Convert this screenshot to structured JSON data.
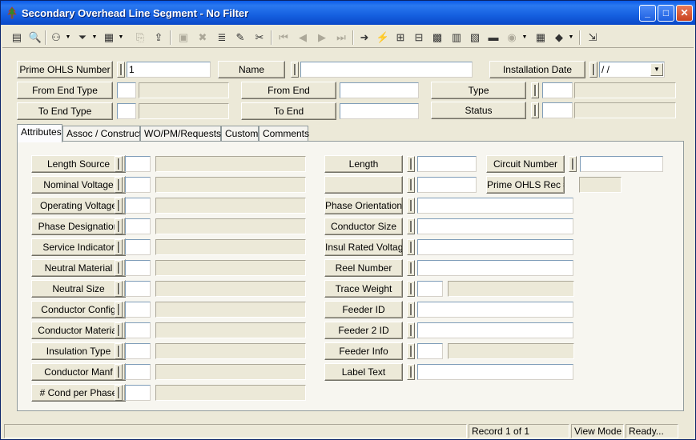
{
  "window": {
    "title": "Secondary Overhead Line Segment - No Filter",
    "buttons": {
      "minimize": "_",
      "maximize": "□",
      "close": "✕"
    }
  },
  "toolbar": {
    "icons": [
      "list-icon",
      "search-icon",
      "binoculars-icon",
      "filter-icon",
      "form-icon",
      "copy-icon",
      "export-icon",
      "save-icon",
      "delete-icon",
      "stack-icon",
      "edit-icon",
      "cut-icon",
      "first-record-icon",
      "prev-record-icon",
      "next-record-icon",
      "last-record-icon",
      "goto-icon",
      "lightning-icon",
      "network-icon",
      "tree-icon",
      "chart-icon",
      "calculator-icon",
      "map-icon",
      "folder-icon",
      "globe-icon",
      "grid-icon",
      "book-icon",
      "exit-icon"
    ]
  },
  "header": {
    "prime_ohls_number": {
      "label": "Prime OHLS Number",
      "value": "1"
    },
    "name": {
      "label": "Name",
      "value": ""
    },
    "installation_date": {
      "label": "Installation Date",
      "value": " /  / "
    },
    "from_end_type": {
      "label": "From End Type",
      "code": "",
      "desc": ""
    },
    "to_end_type": {
      "label": "To End Type",
      "code": "",
      "desc": ""
    },
    "from_end": {
      "label": "From End",
      "value": ""
    },
    "to_end": {
      "label": "To End",
      "value": ""
    },
    "type": {
      "label": "Type",
      "code": "",
      "desc": ""
    },
    "status": {
      "label": "Status",
      "code": "",
      "desc": ""
    }
  },
  "tabs": [
    "Attributes",
    "Assoc / Construct",
    "WO/PM/Requests",
    "Custom",
    "Comments"
  ],
  "attributes": {
    "left": [
      {
        "label": "Length Source",
        "code": "",
        "desc": ""
      },
      {
        "label": "Nominal Voltage",
        "code": "",
        "desc": ""
      },
      {
        "label": "Operating Voltage",
        "code": "",
        "desc": ""
      },
      {
        "label": "Phase Designation",
        "code": "",
        "desc": ""
      },
      {
        "label": "Service Indicator",
        "code": "",
        "desc": ""
      },
      {
        "label": "Neutral Material",
        "code": "",
        "desc": ""
      },
      {
        "label": "Neutral Size",
        "code": "",
        "desc": ""
      },
      {
        "label": "Conductor Config",
        "code": "",
        "desc": ""
      },
      {
        "label": "Conductor Material",
        "code": "",
        "desc": ""
      },
      {
        "label": "Insulation Type",
        "code": "",
        "desc": ""
      },
      {
        "label": "Conductor Manf",
        "code": "",
        "desc": ""
      },
      {
        "label": "# Cond per Phase",
        "code": "",
        "desc": ""
      }
    ],
    "length": {
      "label": "Length",
      "value": ""
    },
    "length_unit": {
      "label": "",
      "value": ""
    },
    "circuit_number": {
      "label": "Circuit Number",
      "value": ""
    },
    "prime_ohls_rec": {
      "label": "Prime OHLS Rec #",
      "value": ""
    },
    "right": [
      {
        "label": "Phase Orientation",
        "value": ""
      },
      {
        "label": "Conductor Size",
        "value": ""
      },
      {
        "label": "Insul Rated Voltage",
        "value": ""
      },
      {
        "label": "Reel Number",
        "value": ""
      },
      {
        "label": "Trace Weight",
        "code": "",
        "desc": ""
      },
      {
        "label": "Feeder ID",
        "value": ""
      },
      {
        "label": "Feeder 2 ID",
        "value": ""
      },
      {
        "label": "Feeder Info",
        "code": "",
        "desc": ""
      },
      {
        "label": "Label Text",
        "value": ""
      }
    ]
  },
  "statusbar": {
    "blank": "",
    "record": "Record 1 of 1",
    "mode": "View Mode",
    "state": "Ready..."
  }
}
